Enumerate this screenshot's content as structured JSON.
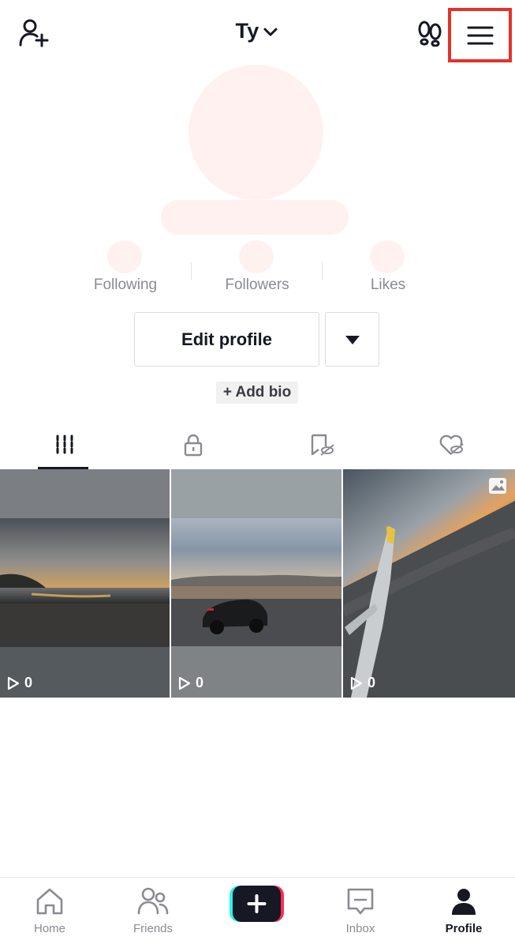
{
  "header": {
    "username": "Ty",
    "icons": [
      "add-friend-icon",
      "chevron-down-icon",
      "footprints-icon",
      "menu-icon"
    ]
  },
  "stats": [
    {
      "label": "Following"
    },
    {
      "label": "Followers"
    },
    {
      "label": "Likes"
    }
  ],
  "profile_actions": {
    "edit_label": "Edit profile",
    "add_bio_label": "+ Add bio"
  },
  "tabs": [
    {
      "icon": "videos-grid-icon",
      "active": true
    },
    {
      "icon": "private-lock-icon",
      "active": false
    },
    {
      "icon": "favorites-hidden-icon",
      "active": false
    },
    {
      "icon": "liked-hidden-icon",
      "active": false
    }
  ],
  "videos": [
    {
      "scene": "beach sunset",
      "views": "0",
      "type": "video"
    },
    {
      "scene": "convertible car at dusk",
      "views": "0",
      "type": "video"
    },
    {
      "scene": "airplane wing over city",
      "views": "0",
      "type": "photo"
    }
  ],
  "bottom_nav": [
    {
      "label": "Home",
      "icon": "home-icon",
      "active": false
    },
    {
      "label": "Friends",
      "icon": "friends-icon",
      "active": false
    },
    {
      "label": "",
      "icon": "create-plus-icon",
      "active": false
    },
    {
      "label": "Inbox",
      "icon": "inbox-icon",
      "active": false
    },
    {
      "label": "Profile",
      "icon": "profile-icon",
      "active": true
    }
  ],
  "colors": {
    "text": "#161823",
    "muted": "#8a8b91",
    "redacted": "#fff1f0",
    "highlight": "#e4322b",
    "create_cyan": "#25f4ee",
    "create_pink": "#fe2c55"
  }
}
